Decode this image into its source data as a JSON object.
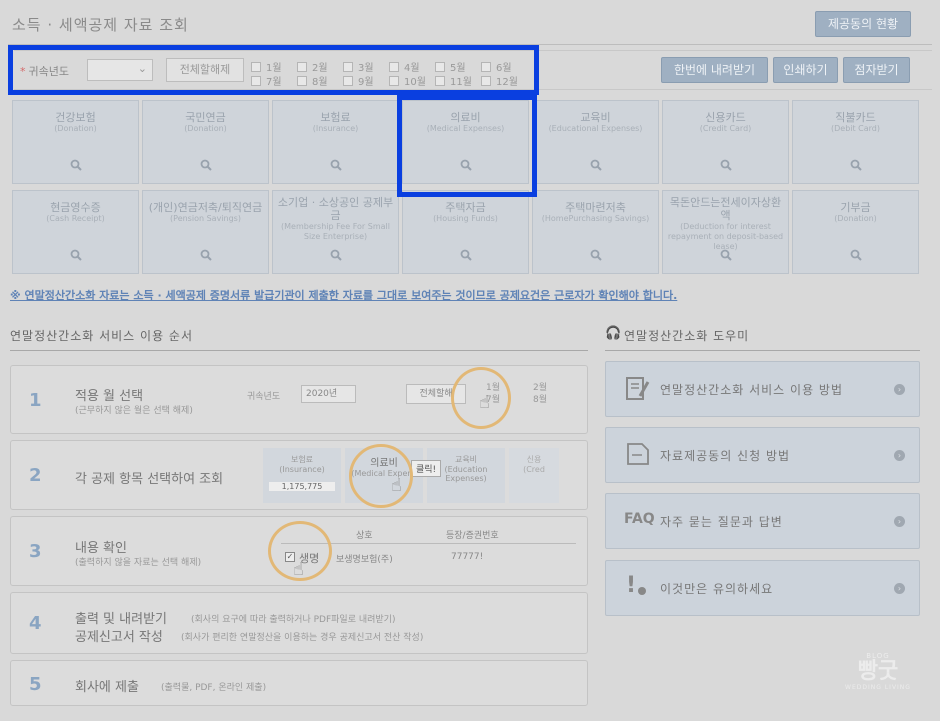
{
  "header": {
    "title": "소득 · 세액공제 자료 조회",
    "share_status_button": "제공동의 현황"
  },
  "filter": {
    "year_label": "귀속년도",
    "year_value": "",
    "clear_all_button": "전체할해제",
    "months": [
      "1월",
      "2월",
      "3월",
      "4월",
      "5월",
      "6월",
      "7월",
      "8월",
      "9월",
      "10월",
      "11월",
      "12월"
    ]
  },
  "toolbar": {
    "download_all": "한번에 내려받기",
    "print": "인쇄하기",
    "save": "점자받기"
  },
  "categories": [
    {
      "name": "건강보험",
      "sub": "(Donation)"
    },
    {
      "name": "국민연금",
      "sub": "(Donation)"
    },
    {
      "name": "보험료",
      "sub": "(Insurance)"
    },
    {
      "name": "의료비",
      "sub": "(Medical Expenses)"
    },
    {
      "name": "교육비",
      "sub": "(Educational Expenses)"
    },
    {
      "name": "신용카드",
      "sub": "(Credit Card)"
    },
    {
      "name": "직불카드",
      "sub": "(Debit Card)"
    },
    {
      "name": "현금영수증",
      "sub": "(Cash Receipt)"
    },
    {
      "name": "(개인)연금저축/퇴직연금",
      "sub": "(Pension Savings)"
    },
    {
      "name": "소기업 · 소상공인 공제부금",
      "sub": "(Membership Fee For Small Size Enterprise)"
    },
    {
      "name": "주택자금",
      "sub": "(Housing Funds)"
    },
    {
      "name": "주택마련저축",
      "sub": "(HomePurchasing Savings)"
    },
    {
      "name": "목돈안드는전세이자상환액",
      "sub": "(Deduction for interest repayment on deposit-based lease)"
    },
    {
      "name": "기부금",
      "sub": "(Donation)"
    }
  ],
  "notice": "※ 연말정산간소화 자료는 소득 · 세액공제 증명서류 발급기관이 제출한 자료를 그대로 보여주는 것이므로 공제요건은 근로자가 확인해야 합니다.",
  "steps_section": {
    "title": "연말정산간소화 서비스 이용 순서",
    "steps": [
      {
        "num": "1",
        "title": "적용 월 선택",
        "sub": "(근무하지 않은 월은 선택 해제)"
      },
      {
        "num": "2",
        "title": "각 공제 항목 선택하여 조회",
        "sub": ""
      },
      {
        "num": "3",
        "title": "내용 확인",
        "sub": "(출력하지 않을 자료는 선택 해제)"
      },
      {
        "num": "4",
        "title": "출력 및 내려받기",
        "sub": "(회사의 요구에 따라 출력하거나 PDF파일로 내려받기)",
        "title2": "공제신고서 작성",
        "sub2": "(회사가 편리한 연말정산을 이용하는 경우 공제신고서 전산 작성)"
      },
      {
        "num": "5",
        "title": "회사에 제출",
        "sub": "(출력물, PDF, 온라인 제출)"
      }
    ],
    "preview1": {
      "label": "귀속년도",
      "year": "2020년",
      "btn": "전체할해",
      "m1": "1월",
      "m7": "7월",
      "m2": "2월",
      "m8": "8월"
    },
    "preview2": {
      "c1": "보험료",
      "c1s": "(Insurance)",
      "c1v": "1,175,775",
      "c2": "의료비",
      "c2s": "(Medical Expens",
      "click": "클릭!",
      "c3": "교육비",
      "c3s": "(Education Expenses)",
      "c4": "신용",
      "c4s": "(Cred"
    },
    "preview3": {
      "h1": "상호",
      "h2": "등장/증권번호",
      "row_name": "생명",
      "row_company": "보생명보험(주)",
      "row_num": "77777!"
    }
  },
  "help_section": {
    "title": "연말정산간소화 도우미",
    "items": [
      {
        "label": "연말정산간소화 서비스 이용 방법"
      },
      {
        "label": "자료제공동의 신청 방법"
      },
      {
        "label": "자주 묻는 질문과 답변",
        "prefix": "FAQ"
      },
      {
        "label": "이것만은 유의하세요"
      }
    ]
  },
  "watermark": {
    "top": "BLOG",
    "main": "빵굿",
    "bottom": "WEDDING LIVING"
  },
  "colors": {
    "highlight": "#0a3fe0",
    "accent_blue": "#5f83b6",
    "ring": "#e2b876"
  }
}
